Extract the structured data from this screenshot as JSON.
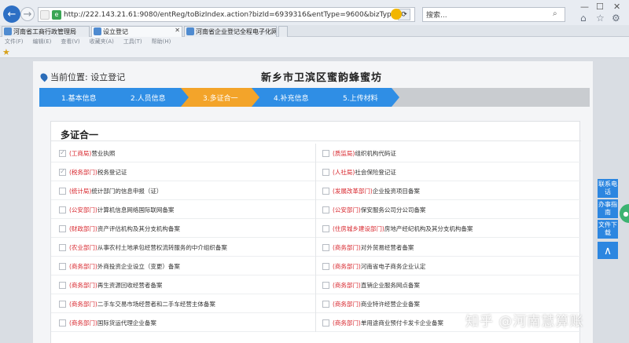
{
  "browser": {
    "url": "http://222.143.21.61:9080/entReg/toBizIndex.action?bizId=6939316&entType=9600&bizType=02",
    "search_placeholder": "搜索...",
    "tabs": [
      {
        "label": "河南省工商行政管理局",
        "active": false
      },
      {
        "label": "设立登记",
        "active": true
      },
      {
        "label": "河南省企业登记全程电子化网...",
        "active": false
      }
    ],
    "menu": [
      "文件(F)",
      "编辑(E)",
      "查看(V)",
      "收藏夹(A)",
      "工具(T)",
      "帮助(H)"
    ]
  },
  "page": {
    "location_label": "当前位置: 设立登记",
    "title": "新乡市卫滨区蜜韵蜂蜜坊",
    "steps": [
      {
        "label": "1.基本信息",
        "state": "done"
      },
      {
        "label": "2.人员信息",
        "state": "done"
      },
      {
        "label": "3.多证合一",
        "state": "current"
      },
      {
        "label": "4.补充信息",
        "state": "todo"
      },
      {
        "label": "5.上传材料",
        "state": "todo"
      }
    ],
    "section_title": "多证合一",
    "items": [
      {
        "dept": "(工商局)",
        "text": "营业执照",
        "checked": true
      },
      {
        "dept": "(质监局)",
        "text": "组织机构代码证",
        "checked": false
      },
      {
        "dept": "(税务部门)",
        "text": "税务登记证",
        "checked": true
      },
      {
        "dept": "(人社局)",
        "text": "社会保险登记证",
        "checked": false
      },
      {
        "dept": "(统计局)",
        "text": "统计部门的信息申报（证）",
        "checked": false
      },
      {
        "dept": "(发展改革部门)",
        "text": "企业投资项目备案",
        "checked": false
      },
      {
        "dept": "(公安部门)",
        "text": "计算机信息网络国际联网备案",
        "checked": false
      },
      {
        "dept": "(公安部门)",
        "text": "保安服务公司分公司备案",
        "checked": false
      },
      {
        "dept": "(财政部门)",
        "text": "资产评估机构及其分支机构备案",
        "checked": false
      },
      {
        "dept": "(住房城乡建设部门)",
        "text": "房地产经纪机构及其分支机构备案",
        "checked": false
      },
      {
        "dept": "(农业部门)",
        "text": "从事农村土地承包经营权流转服务的中介组织备案",
        "checked": false
      },
      {
        "dept": "(商务部门)",
        "text": "对外贸易经营者备案",
        "checked": false
      },
      {
        "dept": "(商务部门)",
        "text": "外商投资企业设立（变更）备案",
        "checked": false
      },
      {
        "dept": "(商务部门)",
        "text": "河南省电子商务企业认定",
        "checked": false
      },
      {
        "dept": "(商务部门)",
        "text": "再生资源回收经营者备案",
        "checked": false
      },
      {
        "dept": "(商务部门)",
        "text": "直销企业服务网点备案",
        "checked": false
      },
      {
        "dept": "(商务部门)",
        "text": "二手车交易市场经营者和二手车经营主体备案",
        "checked": false
      },
      {
        "dept": "(商务部门)",
        "text": "商业特许经营企业备案",
        "checked": false
      },
      {
        "dept": "(商务部门)",
        "text": "国际货运代理企业备案",
        "checked": false
      },
      {
        "dept": "(商务部门)",
        "text": "单用途商业预付卡发卡企业备案",
        "checked": false
      }
    ]
  },
  "side_widgets": {
    "contact": "联系电话",
    "guide": "办事指南",
    "download": "文件下载",
    "up": "∧"
  },
  "watermark": "知乎 @河南慧算账"
}
